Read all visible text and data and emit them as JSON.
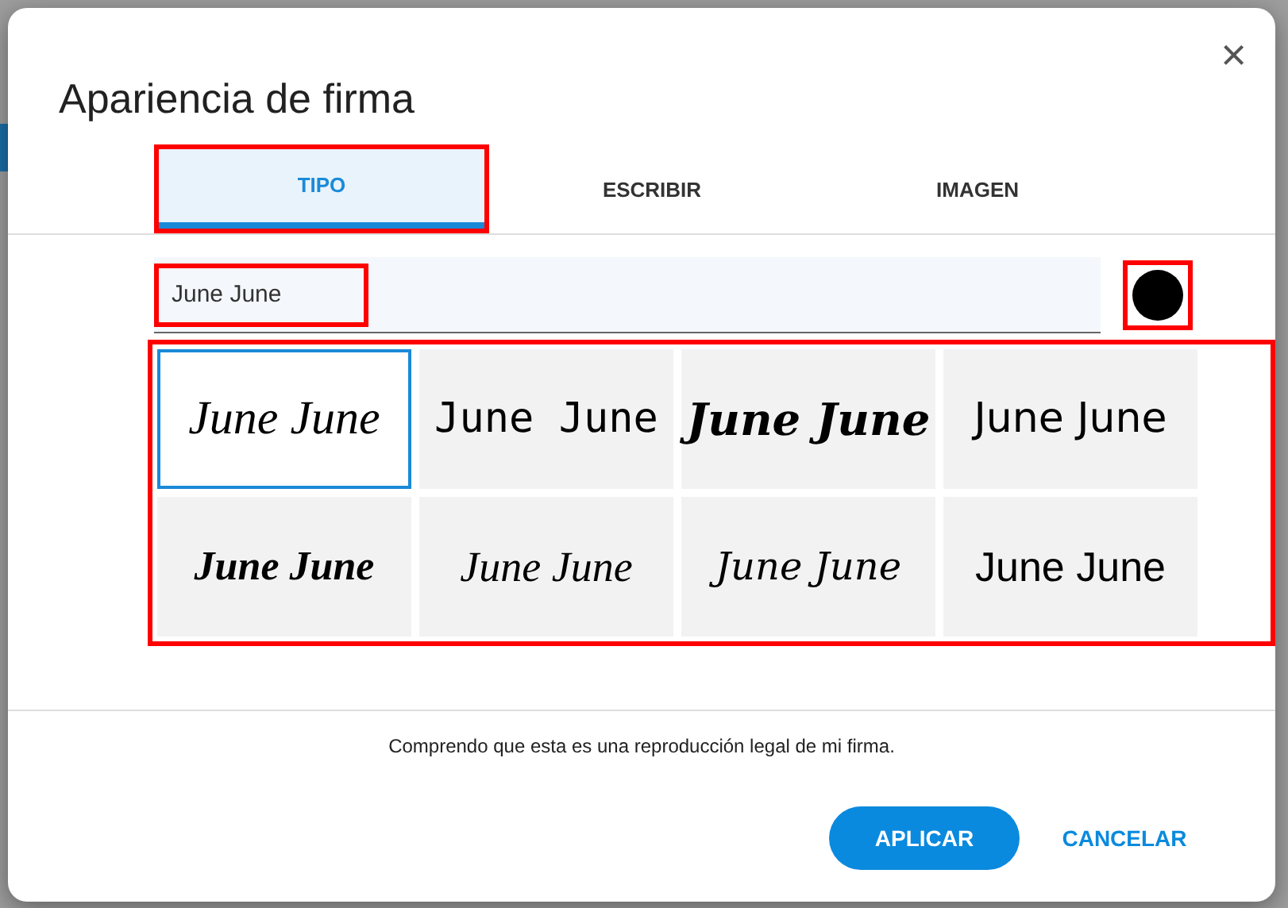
{
  "dialog": {
    "title": "Apariencia de firma",
    "close": "×"
  },
  "tabs": [
    {
      "label": "TIPO",
      "selected": true
    },
    {
      "label": "ESCRIBIR",
      "selected": false
    },
    {
      "label": "IMAGEN",
      "selected": false
    }
  ],
  "name_field": {
    "value": "June June"
  },
  "ink": {
    "color": "#000000"
  },
  "signatures": [
    {
      "text": "June June",
      "kind": "script",
      "selected": true
    },
    {
      "text": "June June",
      "kind": "thin",
      "selected": false
    },
    {
      "text": "June June",
      "kind": "bold",
      "selected": false
    },
    {
      "text": "June June",
      "kind": "print",
      "selected": false
    },
    {
      "text": "June June",
      "kind": "brush",
      "selected": false
    },
    {
      "text": "June June",
      "kind": "light",
      "selected": false
    },
    {
      "text": "June June",
      "kind": "hair",
      "selected": false
    },
    {
      "text": "June June",
      "kind": "plain",
      "selected": false
    }
  ],
  "notice": "Comprendo que esta es una reproducción legal de mi firma.",
  "buttons": [
    {
      "label": "APLICAR",
      "kind": "primary"
    },
    {
      "label": "CANCELAR",
      "kind": "text"
    }
  ]
}
